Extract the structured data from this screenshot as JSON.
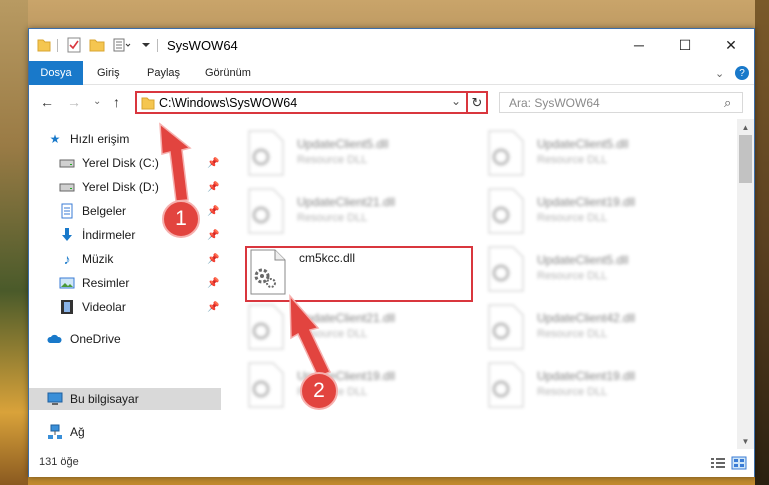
{
  "window": {
    "title": "SysWOW64"
  },
  "titlebar": {
    "minimize": "─",
    "maximize": "☐",
    "close": "✕"
  },
  "ribbon": {
    "tabs": [
      "Dosya",
      "Giriş",
      "Paylaş",
      "Görünüm"
    ],
    "help": "?",
    "expand": "⌄"
  },
  "nav": {
    "back": "←",
    "forward": "→",
    "recent": "⌄",
    "up": "↑",
    "address": "C:\\Windows\\SysWOW64",
    "address_dropdown": "⌄",
    "refresh": "↻",
    "search_placeholder": "Ara: SysWOW64",
    "search_icon": "⌕"
  },
  "sidebar": {
    "items": [
      {
        "label": "Hızlı erişim",
        "icon": "star-icon",
        "pinned": false
      },
      {
        "label": "Yerel Disk (C:)",
        "icon": "drive-icon",
        "pinned": true
      },
      {
        "label": "Yerel Disk (D:)",
        "icon": "drive-icon",
        "pinned": true
      },
      {
        "label": "Belgeler",
        "icon": "documents-icon",
        "pinned": true
      },
      {
        "label": "İndirmeler",
        "icon": "download-icon",
        "pinned": true
      },
      {
        "label": "Müzik",
        "icon": "music-icon",
        "pinned": true
      },
      {
        "label": "Resimler",
        "icon": "pictures-icon",
        "pinned": true
      },
      {
        "label": "Videolar",
        "icon": "video-icon",
        "pinned": true
      },
      {
        "label": "OneDrive",
        "icon": "cloud-icon",
        "pinned": false
      },
      {
        "label": "Bu bilgisayar",
        "icon": "computer-icon",
        "pinned": false
      },
      {
        "label": "Ağ",
        "icon": "network-icon",
        "pinned": false
      }
    ],
    "pin_glyph": "📌"
  },
  "files": {
    "highlighted": {
      "name": "cm5kcc.dll"
    },
    "blurred": [
      {
        "name": "UpdateClient5.dll",
        "desc": "Resource DLL"
      },
      {
        "name": "UpdateClient5.dll",
        "desc": "Resource DLL"
      },
      {
        "name": "UpdateClient21.dll",
        "desc": "Resource DLL"
      },
      {
        "name": "UpdateClient19.dll",
        "desc": "Resource DLL"
      },
      {
        "name": "UpdateClient5.dll",
        "desc": "Resource DLL"
      },
      {
        "name": "UpdateClient21.dll",
        "desc": "Resource DLL"
      },
      {
        "name": "UpdateClient42.dll",
        "desc": "Resource DLL"
      },
      {
        "name": "UpdateClient19.dll",
        "desc": "Resource DLL"
      },
      {
        "name": "UpdateClient19.dll",
        "desc": "Resource DLL"
      }
    ]
  },
  "status": {
    "count": "131 öğe"
  },
  "annotations": {
    "step1": "1",
    "step2": "2",
    "color": "#e2443f"
  }
}
